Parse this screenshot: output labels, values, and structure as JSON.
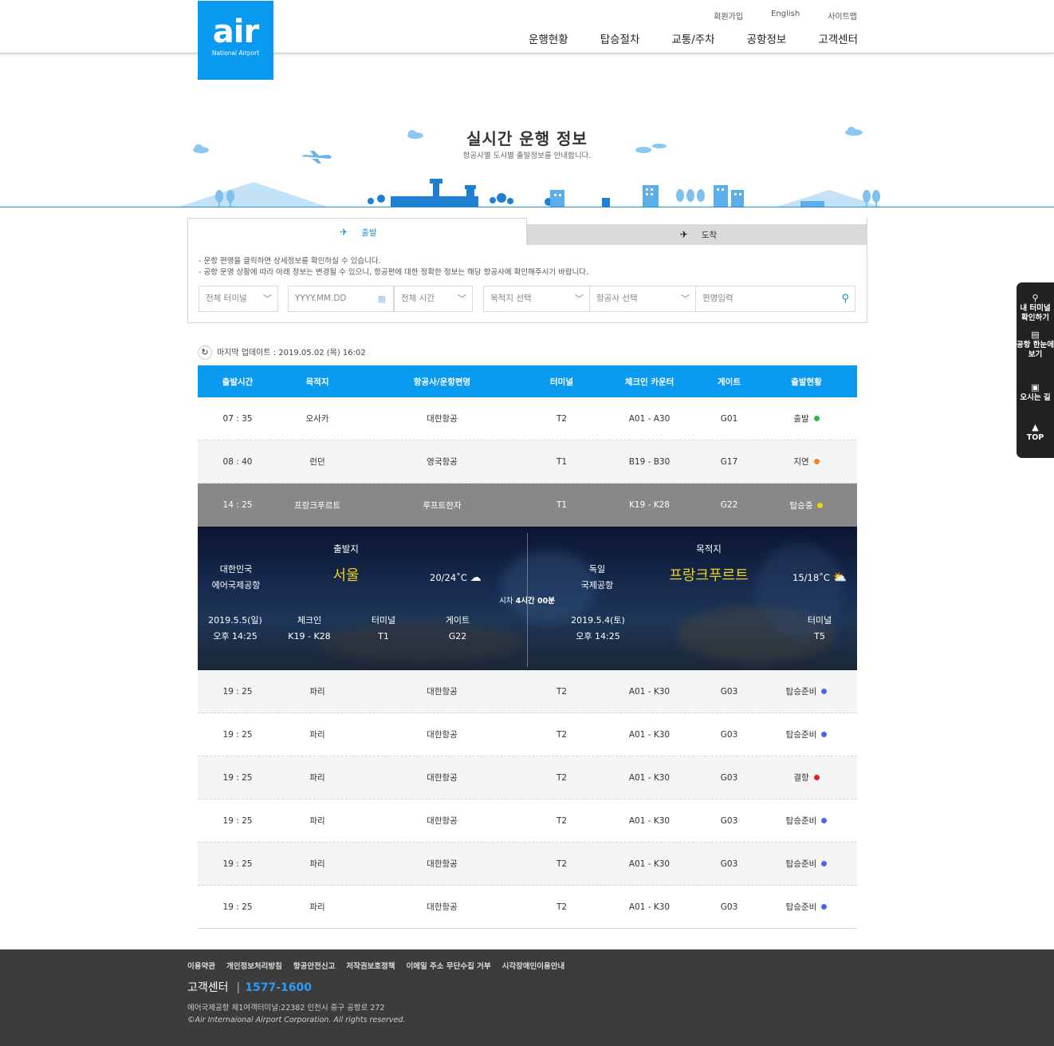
{
  "header": {
    "logo_text": "air",
    "logo_sub": "National Airport",
    "util_links": [
      "회원가입",
      "English",
      "사이트맵"
    ],
    "nav": [
      "운행현황",
      "탑승절차",
      "교통/주차",
      "공항정보",
      "고객센터"
    ]
  },
  "hero": {
    "title": "실시간 운행 정보",
    "subtitle": "항공사별 도시별 출발정보를 안내합니다."
  },
  "tabs": {
    "departure": "출발",
    "arrival": "도착"
  },
  "notices": [
    "- 운항 편명을 클릭하면 상세정보를 확인하실 수 있습니다.",
    "- 공항 운영 상황에 따라 아래 정보는 변경될 수 있으니, 항공편에 대한 정확한 정보는 해당 항공사에 확인해주시기 바랍니다."
  ],
  "filters": {
    "terminal": "전체 터미널",
    "date_placeholder": "YYYY.MM.DD",
    "time": "전체 시간",
    "destination": "목적지 선택",
    "airline": "항공사 선택",
    "flight_placeholder": "편명입력"
  },
  "update": {
    "label": "마지막 업데이트 : 2019.05.02 (목) 16:02"
  },
  "table": {
    "headers": [
      "출발시간",
      "목적지",
      "항공사/운항편명",
      "터미널",
      "체크인 카운터",
      "게이트",
      "출발현황"
    ],
    "rows": [
      {
        "time": "07 : 35",
        "dest": "오사카",
        "airline": "대한항공",
        "terminal": "T2",
        "checkin": "A01 - A30",
        "gate": "G01",
        "status": "출발",
        "status_color": "#2db84c"
      },
      {
        "time": "08 : 40",
        "dest": "런던",
        "airline": "영국항공",
        "terminal": "T1",
        "checkin": "B19 - B30",
        "gate": "G17",
        "status": "지연",
        "status_color": "#f5821f"
      },
      {
        "time": "14 : 25",
        "dest": "프랑크푸르트",
        "airline": "루프트한자",
        "terminal": "T1",
        "checkin": "K19 - K28",
        "gate": "G22",
        "status": "탑승중",
        "status_color": "#f2d11c"
      },
      {
        "time": "19 : 25",
        "dest": "파리",
        "airline": "대한항공",
        "terminal": "T2",
        "checkin": "A01 - K30",
        "gate": "G03",
        "status": "탑승준비",
        "status_color": "#4a67e8"
      },
      {
        "time": "19 : 25",
        "dest": "파리",
        "airline": "대한항공",
        "terminal": "T2",
        "checkin": "A01 - K30",
        "gate": "G03",
        "status": "탑승준비",
        "status_color": "#4a67e8"
      },
      {
        "time": "19 : 25",
        "dest": "파리",
        "airline": "대한항공",
        "terminal": "T2",
        "checkin": "A01 - K30",
        "gate": "G03",
        "status": "결항",
        "status_color": "#e02424"
      },
      {
        "time": "19 : 25",
        "dest": "파리",
        "airline": "대한항공",
        "terminal": "T2",
        "checkin": "A01 - K30",
        "gate": "G03",
        "status": "탑승준비",
        "status_color": "#4a67e8"
      },
      {
        "time": "19 : 25",
        "dest": "파리",
        "airline": "대한항공",
        "terminal": "T2",
        "checkin": "A01 - K30",
        "gate": "G03",
        "status": "탑승준비",
        "status_color": "#4a67e8"
      },
      {
        "time": "19 : 25",
        "dest": "파리",
        "airline": "대한항공",
        "terminal": "T2",
        "checkin": "A01 - K30",
        "gate": "G03",
        "status": "탑승준비",
        "status_color": "#4a67e8"
      }
    ]
  },
  "detail": {
    "origin_label": "출발지",
    "origin_country": "대한민국",
    "origin_airport": "에어국제공항",
    "origin_city": "서울",
    "origin_temp": "20/24˚C",
    "dest_label": "목적지",
    "dest_country": "독일",
    "dest_airport": "국제공항",
    "dest_city": "프랑크푸르트",
    "dest_temp": "15/18˚C",
    "time_diff_prefix": "시차",
    "time_diff_value": "4시간 00분",
    "dep_date": "2019.5.5(일)",
    "dep_time": "오후 14:25",
    "checkin_label": "체크인",
    "checkin_value": "K19 - K28",
    "terminal_label": "터미널",
    "terminal_value": "T1",
    "gate_label": "게이트",
    "gate_value": "G22",
    "arr_date": "2019.5.4(토)",
    "arr_time": "오후 14:25",
    "arr_terminal_label": "터미널",
    "arr_terminal_value": "T5"
  },
  "quick_menu": {
    "terminal": "내 터미널 확인하기",
    "overview": "공항 한눈에 보기",
    "directions": "오시는 길",
    "top": "TOP"
  },
  "footer": {
    "links": [
      "이용약관",
      "개인정보처리방침",
      "항공안전신고",
      "저작권보호정책",
      "이메일 주소 무단수집 거부",
      "시각장애인이용안내"
    ],
    "cs_label": "고객센터",
    "cs_phone": "1577-1600",
    "address": "에어국제공항 제1여객터미널:22382 인천시 중구 공항로 272",
    "copyright": "©Air Internaional Airport Corporation. All rights reserved."
  },
  "colors": {
    "brand": "#0a9af0",
    "selected_row": "#888888",
    "footer_bg": "#3c3c3c",
    "detail_city": "#f2d11c"
  }
}
